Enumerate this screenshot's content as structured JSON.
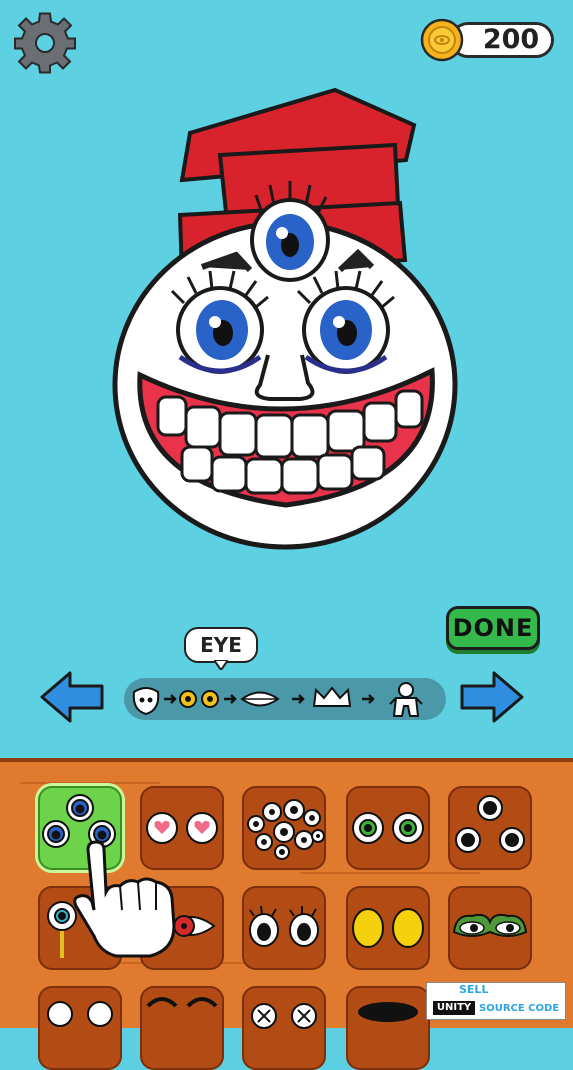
{
  "coins": {
    "value": "200"
  },
  "done_label": "DONE",
  "step_bubble": "EYE",
  "steps": [
    "face",
    "eye",
    "mouth",
    "hat",
    "body"
  ],
  "colors": {
    "sky": "#5dd0e2",
    "panel": "#e07a2e",
    "tile": "#b34b14",
    "selected": "#6cd34b",
    "done": "#35b94a",
    "hat": "#d9232c"
  },
  "watermark": {
    "sell": "SELL",
    "unity": "UNITY",
    "source": "SOURCE CODE"
  },
  "options": [
    {
      "name": "three-blue-eyes",
      "selected": true
    },
    {
      "name": "heart-eyes",
      "selected": false
    },
    {
      "name": "many-eyes",
      "selected": false
    },
    {
      "name": "green-eyes",
      "selected": false
    },
    {
      "name": "triple-dark-eyes",
      "selected": false
    },
    {
      "name": "stalk-eyes",
      "selected": false
    },
    {
      "name": "red-eye",
      "selected": false
    },
    {
      "name": "lashed-eyes",
      "selected": false
    },
    {
      "name": "yellow-eyes",
      "selected": false
    },
    {
      "name": "frog-eyes",
      "selected": false
    }
  ]
}
